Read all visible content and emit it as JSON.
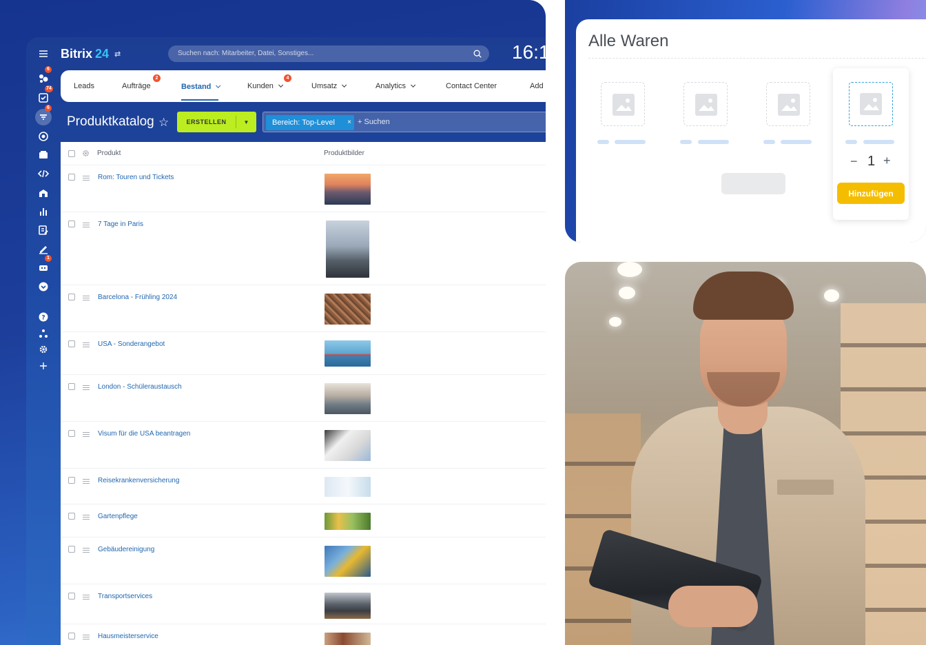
{
  "colors": {
    "brand_blue": "#1d3e9b",
    "accent_blue": "#2066b0",
    "create_green": "#bbed21",
    "badge_red": "#f0532f",
    "add_yellow": "#f5bd00",
    "dashed_blue": "#33a2d8"
  },
  "header": {
    "brand_name": "Bitrix",
    "brand_num": "24",
    "search_placeholder": "Suchen nach: Mitarbeiter, Datei, Sonstiges...",
    "clock": "16:1"
  },
  "sidebar": {
    "items": [
      {
        "icon": "menu-icon"
      },
      {
        "icon": "chat-icon",
        "badge": "6"
      },
      {
        "icon": "tasks-icon",
        "badge": "74"
      },
      {
        "icon": "filter-icon",
        "badge": "6",
        "active": true
      },
      {
        "icon": "target-icon"
      },
      {
        "icon": "contact-card-icon"
      },
      {
        "icon": "code-icon"
      },
      {
        "icon": "building-icon"
      },
      {
        "icon": "bar-chart-icon"
      },
      {
        "icon": "edit-list-icon"
      },
      {
        "icon": "sign-icon"
      },
      {
        "icon": "robot-icon",
        "badge": "1"
      },
      {
        "icon": "chevron-circle-icon"
      },
      {
        "icon": "help-icon"
      },
      {
        "icon": "sitemap-icon"
      },
      {
        "icon": "settings-icon"
      },
      {
        "icon": "plus-icon"
      }
    ]
  },
  "tabs": [
    {
      "label": "Leads"
    },
    {
      "label": "Aufträge",
      "badge": "2"
    },
    {
      "label": "Bestand",
      "active": true,
      "chevron": true
    },
    {
      "label": "Kunden",
      "badge": "4",
      "chevron": true
    },
    {
      "label": "Umsatz",
      "chevron": true
    },
    {
      "label": "Analytics",
      "chevron": true
    },
    {
      "label": "Contact Center"
    },
    {
      "label": "Add"
    }
  ],
  "page": {
    "title": "Produktkatalog",
    "create_label": "ERSTELLEN",
    "filter_chip": "Bereich: Top-Level",
    "filter_chip_close": "×",
    "filter_search": "+ Suchen"
  },
  "table": {
    "col_product": "Produkt",
    "col_images": "Produktbilder",
    "rows": [
      {
        "name": "Rom: Touren und Tickets"
      },
      {
        "name": "7 Tage in Paris"
      },
      {
        "name": "Barcelona - Frühling 2024"
      },
      {
        "name": "USA - Sonderangebot"
      },
      {
        "name": "London - Schüleraustausch"
      },
      {
        "name": "Visum für die USA beantragen"
      },
      {
        "name": "Reisekrankenversicherung"
      },
      {
        "name": "Gartenpflege"
      },
      {
        "name": "Gebäudereinigung"
      },
      {
        "name": "Transportservices"
      },
      {
        "name": "Hausmeisterservice"
      }
    ]
  },
  "catalog_card": {
    "title": "Alle Waren",
    "quantity": "1",
    "minus": "−",
    "plus": "+",
    "add_label": "Hinzufügen"
  }
}
